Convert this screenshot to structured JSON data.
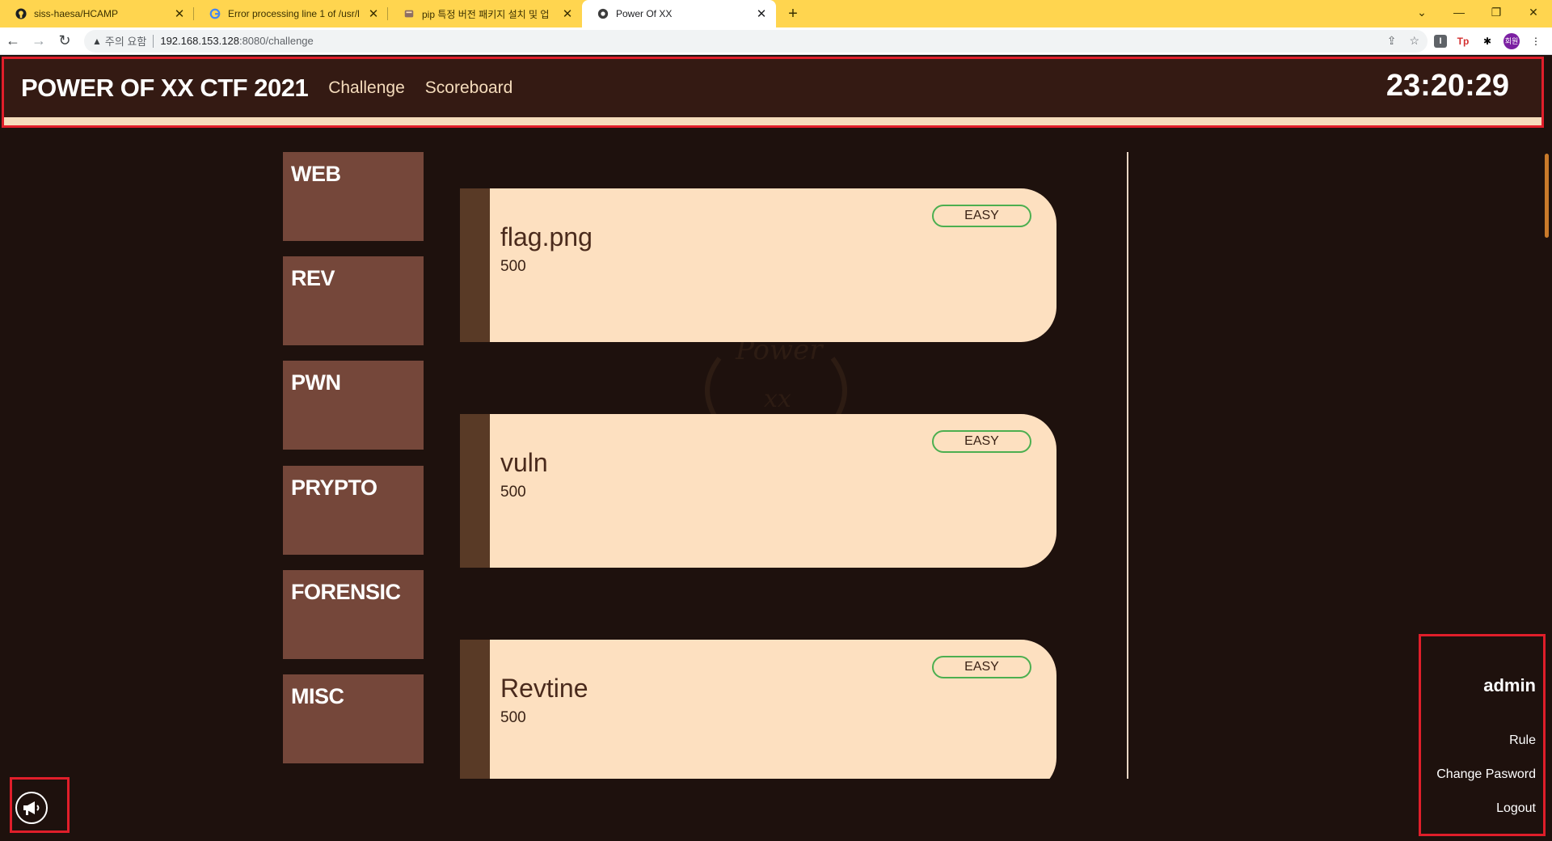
{
  "browser": {
    "tabs": [
      {
        "title": "siss-haesa/HCAMP",
        "icon": "github-icon",
        "active": false
      },
      {
        "title": "Error processing line 1 of /usr/l",
        "icon": "google-icon",
        "active": false
      },
      {
        "title": "pip 특정 버전 패키지 설치 및 업",
        "icon": "blog-icon",
        "active": false
      },
      {
        "title": "Power Of XX",
        "icon": "site-icon",
        "active": true
      }
    ],
    "security_label": "주의 요함",
    "url_host": "192.168.153.128",
    "url_rest": ":8080/challenge",
    "profile_label": "회원"
  },
  "header": {
    "brand": "POWER OF XX CTF 2021",
    "nav": [
      "Challenge",
      "Scoreboard"
    ],
    "clock": "23:20:29"
  },
  "watermark": {
    "text": "Power"
  },
  "categories": [
    "WEB",
    "REV",
    "PWN",
    "PRYPTO",
    "FORENSIC",
    "MISC"
  ],
  "challenges": [
    {
      "name": "flag.png",
      "points": "500",
      "difficulty": "EASY"
    },
    {
      "name": "vuln",
      "points": "500",
      "difficulty": "EASY"
    },
    {
      "name": "Revtine",
      "points": "500",
      "difficulty": "EASY"
    }
  ],
  "user": {
    "name": "admin",
    "links": [
      "Rule",
      "Change Pasword",
      "Logout"
    ]
  },
  "colors": {
    "background": "#1e110d",
    "header_bar": "#341a13",
    "category_tile": "#75473a",
    "card": "#fde0c0",
    "card_stripe": "#593a26",
    "badge_border": "#4caf50",
    "highlight_box": "#e01e2a"
  }
}
